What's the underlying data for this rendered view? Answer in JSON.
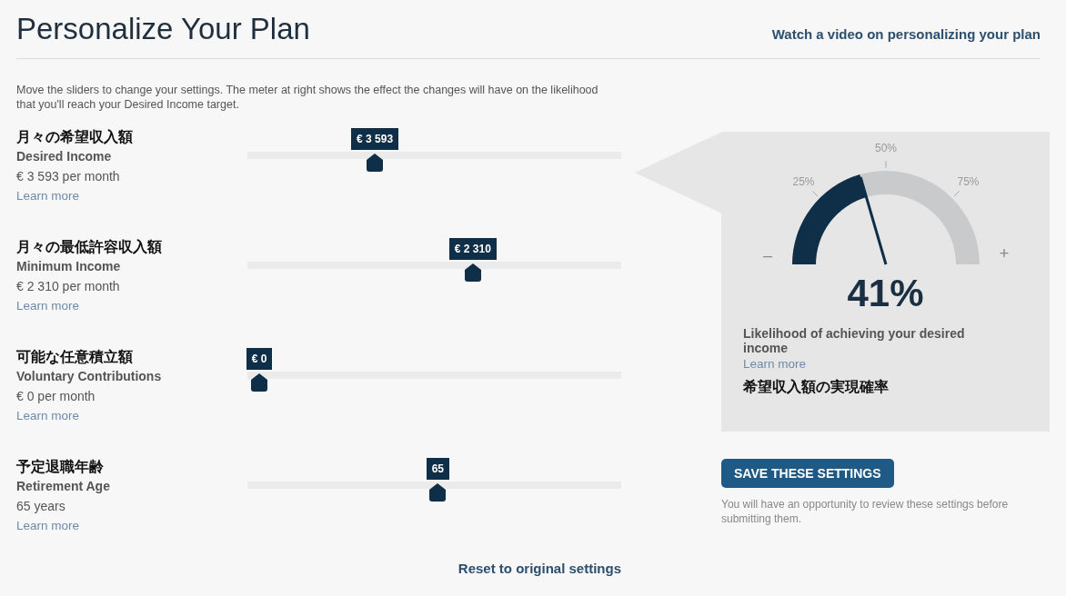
{
  "title": "Personalize Your Plan",
  "video_link": "Watch a video on personalizing your plan",
  "intro": "Move the sliders to change your settings. The meter at right shows the effect the changes will have on the likelihood that you'll reach your Desired Income target.",
  "sliders": [
    {
      "label_ja": "月々の希望収入額",
      "label": "Desired Income",
      "reading": "€ 3 593 per month",
      "link": "Learn more",
      "bubble": "€ 3 593",
      "level": 0.33
    },
    {
      "label_ja": "月々の最低許容収入額",
      "label": "Minimum Income",
      "reading": "€ 2 310 per month",
      "link": "Learn more",
      "bubble": "€ 2 310",
      "level": 0.61
    },
    {
      "label_ja": "可能な任意積立額",
      "label": "Voluntary Contributions",
      "reading": "€ 0 per month",
      "link": "Learn more",
      "bubble": "€ 0",
      "level": 0
    },
    {
      "label_ja": "予定退職年齢",
      "label": "Retirement Age",
      "reading": "65 years",
      "link": "Learn more",
      "bubble": "65",
      "level": 0.51
    }
  ],
  "reset_link": "Reset to original settings",
  "meter": {
    "level": 0.41,
    "ticks": [
      "25%",
      "50%",
      "75%"
    ],
    "minus": "–",
    "plus": "+",
    "reading": "41%",
    "caption": "Likelihood of achieving your desired income",
    "link": "Learn more",
    "caption_ja": "希望収入額の実現確率"
  },
  "save_button": "SAVE THESE SETTINGS",
  "note": "You will have an opportunity to review these settings before submitting them."
}
